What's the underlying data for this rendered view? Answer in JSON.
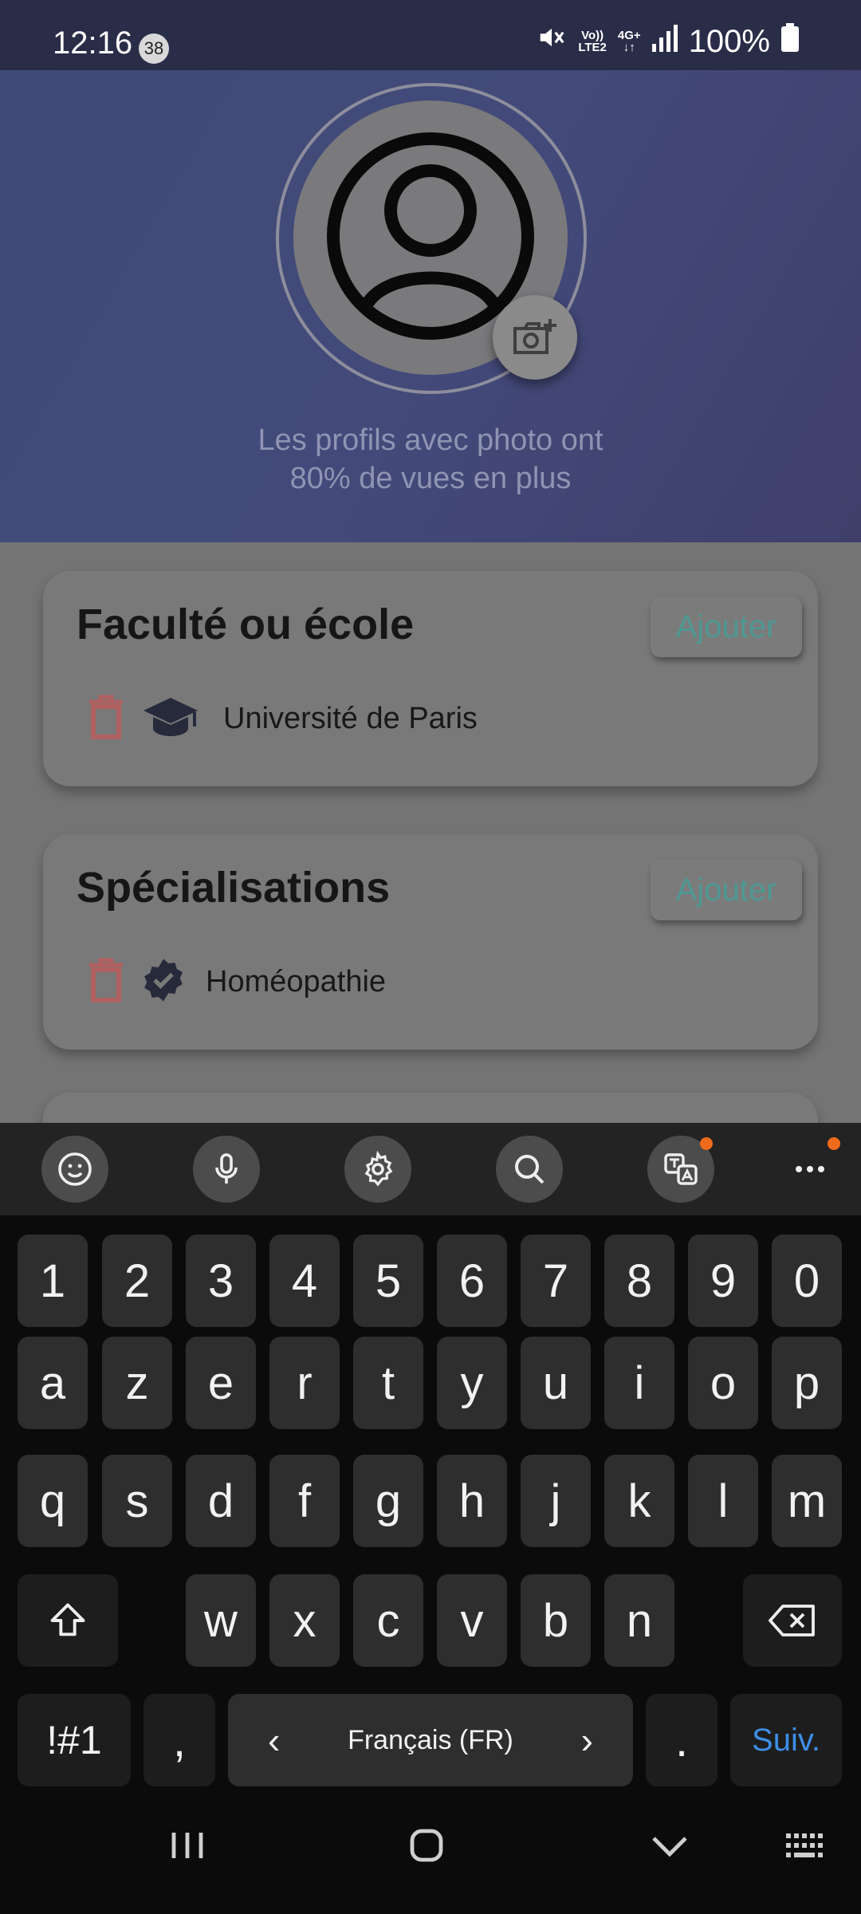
{
  "status_bar": {
    "time": "12:16",
    "notification_count": "38",
    "volte_label_top": "Vo))",
    "volte_label_bottom": "LTE2",
    "network_label": "4G+",
    "battery": "100%"
  },
  "profile": {
    "photo_hint_line1": "Les profils avec photo ont",
    "photo_hint_line2": "80% de vues en plus"
  },
  "cards": {
    "faculty": {
      "title": "Faculté ou école",
      "add_label": "Ajouter",
      "item_icon": "graduation-cap-icon",
      "item": "Université de Paris"
    },
    "specializations": {
      "title": "Spécialisations",
      "add_label": "Ajouter",
      "item_icon": "verified-badge-icon",
      "item": "Homéopathie"
    }
  },
  "colors": {
    "accent": "#4e9892",
    "delete": "#b06060",
    "header": "#434a7a",
    "keyboard_action": "#3d8ee8"
  },
  "keyboard": {
    "toolbar": [
      "emoji-icon",
      "microphone-icon",
      "settings-icon",
      "search-icon",
      "translate-icon",
      "more-icon"
    ],
    "row_numbers": [
      "1",
      "2",
      "3",
      "4",
      "5",
      "6",
      "7",
      "8",
      "9",
      "0"
    ],
    "row1": [
      "a",
      "z",
      "e",
      "r",
      "t",
      "y",
      "u",
      "i",
      "o",
      "p"
    ],
    "row2": [
      "q",
      "s",
      "d",
      "f",
      "g",
      "h",
      "j",
      "k",
      "l",
      "m"
    ],
    "row3": [
      "w",
      "x",
      "c",
      "v",
      "b",
      "n"
    ],
    "symbols_label": "!#1",
    "comma": ",",
    "space_label": "Français (FR)",
    "space_left": "‹",
    "space_right": "›",
    "period": ".",
    "action_label": "Suiv."
  }
}
